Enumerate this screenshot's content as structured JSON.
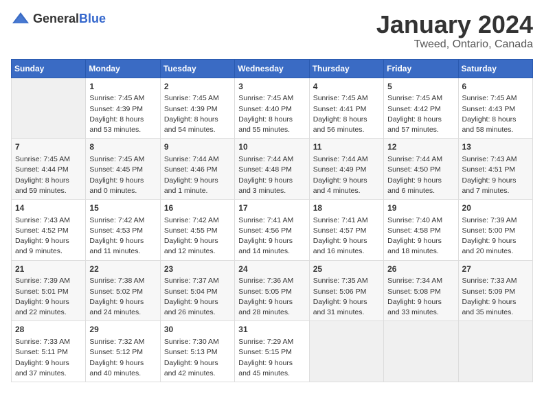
{
  "header": {
    "logo_general": "General",
    "logo_blue": "Blue",
    "month": "January 2024",
    "location": "Tweed, Ontario, Canada"
  },
  "weekdays": [
    "Sunday",
    "Monday",
    "Tuesday",
    "Wednesday",
    "Thursday",
    "Friday",
    "Saturday"
  ],
  "weeks": [
    [
      {
        "day": "",
        "sunrise": "",
        "sunset": "",
        "daylight": ""
      },
      {
        "day": "1",
        "sunrise": "Sunrise: 7:45 AM",
        "sunset": "Sunset: 4:39 PM",
        "daylight": "Daylight: 8 hours and 53 minutes."
      },
      {
        "day": "2",
        "sunrise": "Sunrise: 7:45 AM",
        "sunset": "Sunset: 4:39 PM",
        "daylight": "Daylight: 8 hours and 54 minutes."
      },
      {
        "day": "3",
        "sunrise": "Sunrise: 7:45 AM",
        "sunset": "Sunset: 4:40 PM",
        "daylight": "Daylight: 8 hours and 55 minutes."
      },
      {
        "day": "4",
        "sunrise": "Sunrise: 7:45 AM",
        "sunset": "Sunset: 4:41 PM",
        "daylight": "Daylight: 8 hours and 56 minutes."
      },
      {
        "day": "5",
        "sunrise": "Sunrise: 7:45 AM",
        "sunset": "Sunset: 4:42 PM",
        "daylight": "Daylight: 8 hours and 57 minutes."
      },
      {
        "day": "6",
        "sunrise": "Sunrise: 7:45 AM",
        "sunset": "Sunset: 4:43 PM",
        "daylight": "Daylight: 8 hours and 58 minutes."
      }
    ],
    [
      {
        "day": "7",
        "sunrise": "Sunrise: 7:45 AM",
        "sunset": "Sunset: 4:44 PM",
        "daylight": "Daylight: 8 hours and 59 minutes."
      },
      {
        "day": "8",
        "sunrise": "Sunrise: 7:45 AM",
        "sunset": "Sunset: 4:45 PM",
        "daylight": "Daylight: 9 hours and 0 minutes."
      },
      {
        "day": "9",
        "sunrise": "Sunrise: 7:44 AM",
        "sunset": "Sunset: 4:46 PM",
        "daylight": "Daylight: 9 hours and 1 minute."
      },
      {
        "day": "10",
        "sunrise": "Sunrise: 7:44 AM",
        "sunset": "Sunset: 4:48 PM",
        "daylight": "Daylight: 9 hours and 3 minutes."
      },
      {
        "day": "11",
        "sunrise": "Sunrise: 7:44 AM",
        "sunset": "Sunset: 4:49 PM",
        "daylight": "Daylight: 9 hours and 4 minutes."
      },
      {
        "day": "12",
        "sunrise": "Sunrise: 7:44 AM",
        "sunset": "Sunset: 4:50 PM",
        "daylight": "Daylight: 9 hours and 6 minutes."
      },
      {
        "day": "13",
        "sunrise": "Sunrise: 7:43 AM",
        "sunset": "Sunset: 4:51 PM",
        "daylight": "Daylight: 9 hours and 7 minutes."
      }
    ],
    [
      {
        "day": "14",
        "sunrise": "Sunrise: 7:43 AM",
        "sunset": "Sunset: 4:52 PM",
        "daylight": "Daylight: 9 hours and 9 minutes."
      },
      {
        "day": "15",
        "sunrise": "Sunrise: 7:42 AM",
        "sunset": "Sunset: 4:53 PM",
        "daylight": "Daylight: 9 hours and 11 minutes."
      },
      {
        "day": "16",
        "sunrise": "Sunrise: 7:42 AM",
        "sunset": "Sunset: 4:55 PM",
        "daylight": "Daylight: 9 hours and 12 minutes."
      },
      {
        "day": "17",
        "sunrise": "Sunrise: 7:41 AM",
        "sunset": "Sunset: 4:56 PM",
        "daylight": "Daylight: 9 hours and 14 minutes."
      },
      {
        "day": "18",
        "sunrise": "Sunrise: 7:41 AM",
        "sunset": "Sunset: 4:57 PM",
        "daylight": "Daylight: 9 hours and 16 minutes."
      },
      {
        "day": "19",
        "sunrise": "Sunrise: 7:40 AM",
        "sunset": "Sunset: 4:58 PM",
        "daylight": "Daylight: 9 hours and 18 minutes."
      },
      {
        "day": "20",
        "sunrise": "Sunrise: 7:39 AM",
        "sunset": "Sunset: 5:00 PM",
        "daylight": "Daylight: 9 hours and 20 minutes."
      }
    ],
    [
      {
        "day": "21",
        "sunrise": "Sunrise: 7:39 AM",
        "sunset": "Sunset: 5:01 PM",
        "daylight": "Daylight: 9 hours and 22 minutes."
      },
      {
        "day": "22",
        "sunrise": "Sunrise: 7:38 AM",
        "sunset": "Sunset: 5:02 PM",
        "daylight": "Daylight: 9 hours and 24 minutes."
      },
      {
        "day": "23",
        "sunrise": "Sunrise: 7:37 AM",
        "sunset": "Sunset: 5:04 PM",
        "daylight": "Daylight: 9 hours and 26 minutes."
      },
      {
        "day": "24",
        "sunrise": "Sunrise: 7:36 AM",
        "sunset": "Sunset: 5:05 PM",
        "daylight": "Daylight: 9 hours and 28 minutes."
      },
      {
        "day": "25",
        "sunrise": "Sunrise: 7:35 AM",
        "sunset": "Sunset: 5:06 PM",
        "daylight": "Daylight: 9 hours and 31 minutes."
      },
      {
        "day": "26",
        "sunrise": "Sunrise: 7:34 AM",
        "sunset": "Sunset: 5:08 PM",
        "daylight": "Daylight: 9 hours and 33 minutes."
      },
      {
        "day": "27",
        "sunrise": "Sunrise: 7:33 AM",
        "sunset": "Sunset: 5:09 PM",
        "daylight": "Daylight: 9 hours and 35 minutes."
      }
    ],
    [
      {
        "day": "28",
        "sunrise": "Sunrise: 7:33 AM",
        "sunset": "Sunset: 5:11 PM",
        "daylight": "Daylight: 9 hours and 37 minutes."
      },
      {
        "day": "29",
        "sunrise": "Sunrise: 7:32 AM",
        "sunset": "Sunset: 5:12 PM",
        "daylight": "Daylight: 9 hours and 40 minutes."
      },
      {
        "day": "30",
        "sunrise": "Sunrise: 7:30 AM",
        "sunset": "Sunset: 5:13 PM",
        "daylight": "Daylight: 9 hours and 42 minutes."
      },
      {
        "day": "31",
        "sunrise": "Sunrise: 7:29 AM",
        "sunset": "Sunset: 5:15 PM",
        "daylight": "Daylight: 9 hours and 45 minutes."
      },
      {
        "day": "",
        "sunrise": "",
        "sunset": "",
        "daylight": ""
      },
      {
        "day": "",
        "sunrise": "",
        "sunset": "",
        "daylight": ""
      },
      {
        "day": "",
        "sunrise": "",
        "sunset": "",
        "daylight": ""
      }
    ]
  ]
}
